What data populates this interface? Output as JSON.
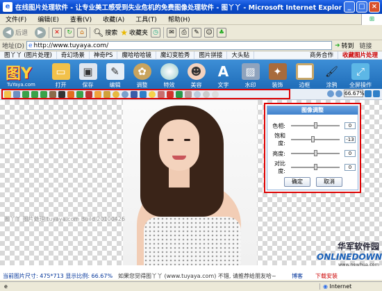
{
  "window": {
    "title": "在线图片处理软件 - 让专业美工感受到失业危机的免费图像处理软件 - 图丫丫 - Microsoft Internet Explorer"
  },
  "menu": [
    "文件(F)",
    "编辑(E)",
    "查看(V)",
    "收藏(A)",
    "工具(T)",
    "帮助(H)"
  ],
  "nav": {
    "back": "后退",
    "search": "搜索",
    "favorites": "收藏夹"
  },
  "address": {
    "label": "地址(D)",
    "url": "http://www.tuyaya.com/",
    "go": "转到",
    "links": "链接"
  },
  "apptabs": [
    "图丫丫 (图片处理)",
    "奇幻场景",
    "神奇PS",
    "魔哈哈哈镜",
    "魔幻变脸秀",
    "图片拼接",
    "大头贴"
  ],
  "apptabs_right": {
    "business": "商务合作",
    "favorite": "收藏图片处理"
  },
  "logo": {
    "sub": "TuYaya.com"
  },
  "tools": [
    {
      "label": "打开",
      "icon": "folder-icon"
    },
    {
      "label": "保存",
      "icon": "floppy-icon"
    },
    {
      "label": "编辑",
      "icon": "edit-icon"
    },
    {
      "label": "调整",
      "icon": "palette-icon"
    },
    {
      "label": "特效",
      "icon": "sphere-icon"
    },
    {
      "label": "美容",
      "icon": "face-icon"
    },
    {
      "label": "文字",
      "icon": "text-icon"
    },
    {
      "label": "水印",
      "icon": "watermark-icon"
    },
    {
      "label": "装饰",
      "icon": "decoration-icon"
    },
    {
      "label": "边框",
      "icon": "frame-icon"
    },
    {
      "label": "涂鸦",
      "icon": "brush-icon"
    },
    {
      "label": "全屏操作",
      "icon": "fullscreen-icon"
    }
  ],
  "zoom": "66.67%",
  "panel": {
    "title": "图像调整",
    "rows": [
      {
        "label": "色相:",
        "value": "0",
        "level": 0.5
      },
      {
        "label": "饱和度:",
        "value": "-13",
        "level": 0.45
      },
      {
        "label": "亮度:",
        "value": "0",
        "level": 0.5
      },
      {
        "label": "对比度:",
        "value": "0",
        "level": 0.5
      }
    ],
    "ok": "确定",
    "cancel": "取消"
  },
  "watermark": "图丫丫 图片处理 tuyaya.com Build 20100426",
  "brand": {
    "cn": "华军软件园",
    "en": "ONLINEDOWN",
    "url": "www.newhua.com"
  },
  "status": {
    "size": "当前图片尺寸: 475*713 显示比例: 66.67%",
    "message": "如果您觉得图丫丫 (www.tuyaya.com) 不错, 请推荐给朋友哈~",
    "blog": "博客",
    "download": "下载安装"
  },
  "ie_status": {
    "zone": "Internet"
  }
}
